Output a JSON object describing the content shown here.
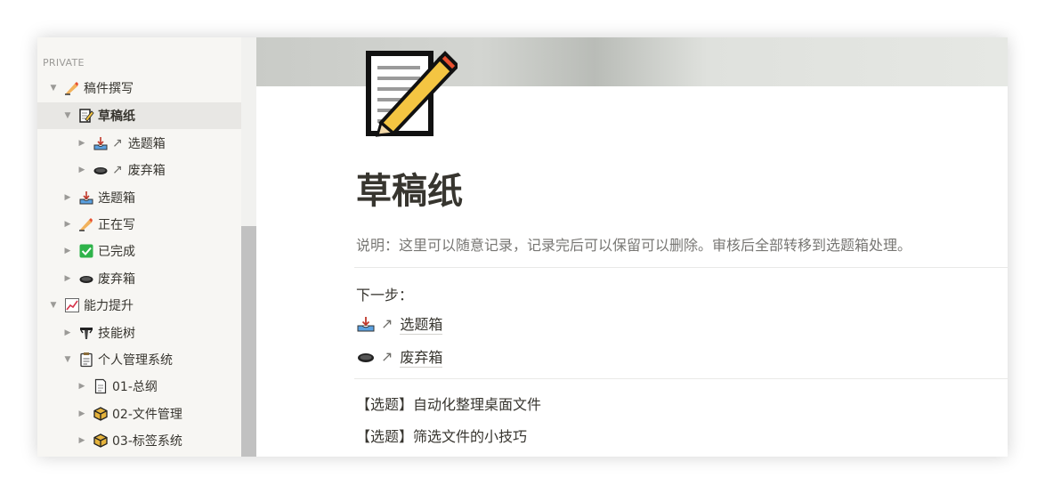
{
  "sidebar": {
    "section_title": "PRIVATE",
    "items": [
      {
        "label": "稿件撰写",
        "caret": "▼",
        "icon": "writing-hand-icon"
      },
      {
        "label": "草稿纸",
        "caret": "▼",
        "icon": "memo-icon"
      },
      {
        "label": "选题箱",
        "caret": "▶",
        "icon": "inbox-tray-icon",
        "arrow": "↗"
      },
      {
        "label": "废弃箱",
        "caret": "▶",
        "icon": "hole-icon",
        "arrow": "↗"
      },
      {
        "label": "选题箱",
        "caret": "▶",
        "icon": "inbox-tray-icon"
      },
      {
        "label": "正在写",
        "caret": "▶",
        "icon": "writing-hand-icon"
      },
      {
        "label": "已完成",
        "caret": "▶",
        "icon": "check-box-icon"
      },
      {
        "label": "废弃箱",
        "caret": "▶",
        "icon": "hole-icon"
      },
      {
        "label": "能力提升",
        "caret": "▼",
        "icon": "chart-increasing-icon"
      },
      {
        "label": "技能树",
        "caret": "▶",
        "icon": "tree-icon"
      },
      {
        "label": "个人管理系统",
        "caret": "▼",
        "icon": "clipboard-icon"
      },
      {
        "label": "01-总纲",
        "caret": "▶",
        "icon": "page-icon"
      },
      {
        "label": "02-文件管理",
        "caret": "▶",
        "icon": "package-icon"
      },
      {
        "label": "03-标签系统",
        "caret": "▶",
        "icon": "package-icon"
      }
    ]
  },
  "page": {
    "icon": "memo-icon",
    "title": "草稿纸",
    "description": "说明：这里可以随意记录，记录完后可以保留可以删除。审核后全部转移到选题箱处理。",
    "next_step_label": "下一步：",
    "links": [
      {
        "arrow": "↗",
        "label": "选题箱",
        "icon": "inbox-tray-icon"
      },
      {
        "arrow": "↗",
        "label": "废弃箱",
        "icon": "hole-icon"
      }
    ],
    "topics": [
      "【选题】自动化整理桌面文件",
      "【选题】筛选文件的小技巧"
    ]
  },
  "colors": {
    "sidebar_bg": "#f7f6f3",
    "selected_bg": "#e8e7e4",
    "text": "#37352f",
    "muted": "#787774"
  }
}
